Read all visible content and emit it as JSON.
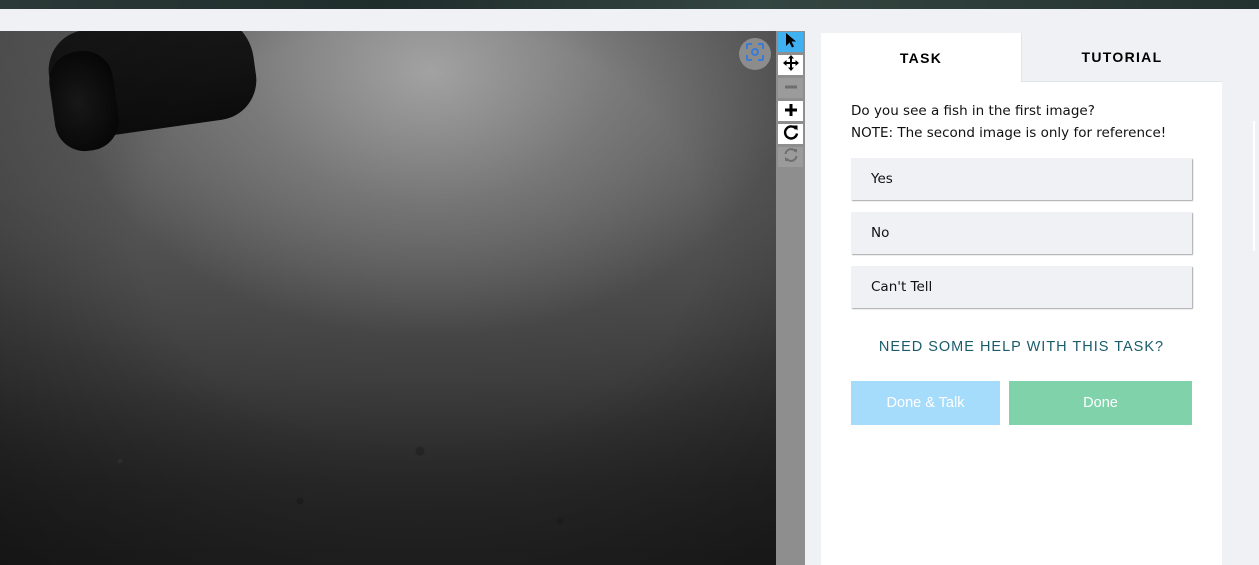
{
  "viewer": {
    "recenter_icon": "recenter-icon"
  },
  "toolbar": {
    "tools": [
      {
        "name": "pointer",
        "icon": "pointer-icon",
        "state": "active"
      },
      {
        "name": "move",
        "icon": "move-icon",
        "state": "normal"
      },
      {
        "name": "zoom-out",
        "icon": "minus-icon",
        "state": "disabled"
      },
      {
        "name": "zoom-in",
        "icon": "plus-icon",
        "state": "normal"
      },
      {
        "name": "rotate",
        "icon": "rotate-icon",
        "state": "normal"
      },
      {
        "name": "reset",
        "icon": "refresh-icon",
        "state": "disabled"
      }
    ]
  },
  "task_panel": {
    "tabs": [
      {
        "label": "TASK",
        "active": true
      },
      {
        "label": "TUTORIAL",
        "active": false
      }
    ],
    "question_line1": "Do you see a fish in the first image?",
    "question_line2": "NOTE: The second image is only for reference!",
    "answers": [
      "Yes",
      "No",
      "Can't Tell"
    ],
    "help_link": "NEED SOME HELP WITH THIS TASK?",
    "done_talk_label": "Done & Talk",
    "done_label": "Done"
  },
  "colors": {
    "accent_blue": "#3fb1f0",
    "done_talk_bg": "#a6dcfb",
    "done_bg": "#7fd2aa",
    "help_link": "#1a5c6a",
    "page_bg": "#eff1f4"
  }
}
